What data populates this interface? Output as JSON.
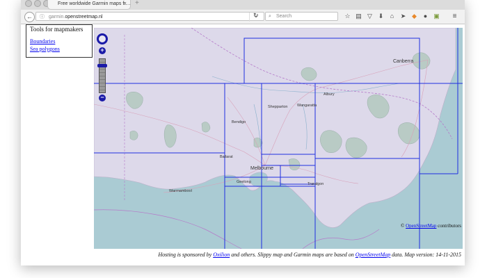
{
  "browser": {
    "tab_title": "Free worldwide Garmin maps fr…",
    "tab_close": "×",
    "new_tab": "+",
    "url_prefix": "garmin.",
    "url_host": "openstreetmap.nl",
    "search_placeholder": "Search",
    "icons": [
      "star-icon",
      "reading-list-icon",
      "pocket-icon",
      "download-icon",
      "home-icon",
      "send-icon",
      "extension-orange-icon",
      "chat-icon",
      "screenshot-icon",
      "menu-icon"
    ]
  },
  "tools": {
    "title": "Tools for mapmakers",
    "links": [
      "Boundaries",
      "Sea polygons"
    ]
  },
  "map": {
    "cities": [
      "Canberra",
      "Albury",
      "Shepparton",
      "Wangaratta",
      "Bendigo",
      "Ballarat",
      "Melbourne",
      "Geelong",
      "Traralgon",
      "Warrnambool"
    ],
    "attribution_prefix": "©",
    "attribution_link": "OpenStreetMap",
    "attribution_suffix": "contributors",
    "colors": {
      "land": "#ddd9ea",
      "sea": "#aacbd3",
      "tile_border": "#1f2ee0",
      "forest": "#b9cbc5"
    }
  },
  "footer": {
    "part1": "Hosting is sponsored by",
    "link1": "Oxilion",
    "part2": "and others. Slippy map and Garmin maps are based on",
    "link2": "OpenStreetMap",
    "part3": "data. Map version: 14-11-2015"
  }
}
